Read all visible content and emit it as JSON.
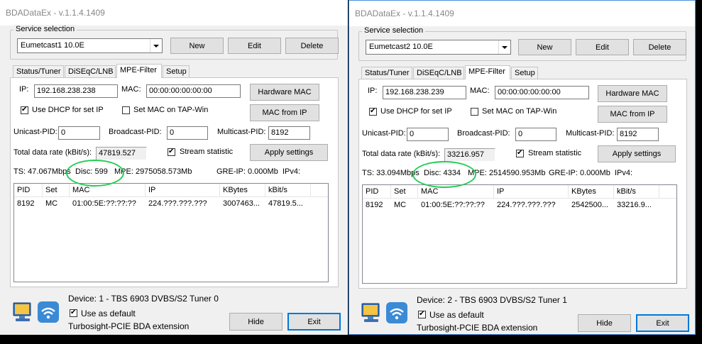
{
  "windows": [
    {
      "title": "BDADataEx - v.1.1.4.1409",
      "service_selection_label": "Service selection",
      "service_selected": "Eumetcast1 10.0E",
      "buttons": {
        "new": "New",
        "edit": "Edit",
        "delete": "Delete",
        "hardware_mac": "Hardware MAC",
        "mac_from_ip": "MAC from IP",
        "apply_settings": "Apply settings",
        "hide": "Hide",
        "exit": "Exit"
      },
      "tabs": [
        "Status/Tuner",
        "DiSEqC/LNB",
        "MPE-Filter",
        "Setup"
      ],
      "active_tab": 2,
      "ip_label": "IP:",
      "ip_value": "192.168.238.238",
      "mac_label": "MAC:",
      "mac_value": "00:00:00:00:00:00",
      "dhcp_label": "Use DHCP for set IP",
      "dhcp_checked": true,
      "set_mac_label": "Set MAC on TAP-Win",
      "set_mac_checked": false,
      "unicast_label": "Unicast-PID:",
      "unicast_value": "0",
      "broadcast_label": "Broadcast-PID:",
      "broadcast_value": "0",
      "multicast_label": "Multicast-PID:",
      "multicast_value": "8192",
      "total_rate_label": "Total data rate (kBit/s):",
      "total_rate_value": "47819.527",
      "stream_stat_label": "Stream statistic",
      "stream_stat_checked": true,
      "status": {
        "ts": "TS: 47.067Mbps",
        "disc": "Disc: 599",
        "mpe": "MPE: 2975058.573Mb",
        "gre": "GRE-IP: 0.000Mb",
        "ipv4": "IPv4:"
      },
      "table": {
        "columns": [
          "PID",
          "Set",
          "MAC",
          "IP",
          "KBytes",
          "kBit/s"
        ],
        "rows": [
          [
            "8192",
            "MC",
            "01:00:5E:??:??:??",
            "224.???.???.???",
            "3007463...",
            "47819.5..."
          ]
        ]
      },
      "device": "Device: 1 - TBS 6903 DVBS/S2 Tuner 0",
      "use_default_label": "Use as default",
      "use_default_checked": true,
      "extension": "Turbosight-PCIE BDA extension",
      "icons": [
        "computer-icon",
        "wifi-icon"
      ],
      "highlight_color": "#22cc55"
    },
    {
      "title": "BDADataEx - v.1.1.4.1409",
      "service_selection_label": "Service selection",
      "service_selected": "Eumetcast2 10.0E",
      "buttons": {
        "new": "New",
        "edit": "Edit",
        "delete": "Delete",
        "hardware_mac": "Hardware MAC",
        "mac_from_ip": "MAC from IP",
        "apply_settings": "Apply settings",
        "hide": "Hide",
        "exit": "Exit"
      },
      "tabs": [
        "Status/Tuner",
        "DiSEqC/LNB",
        "MPE-Filter",
        "Setup"
      ],
      "active_tab": 2,
      "ip_label": "IP:",
      "ip_value": "192.168.238.239",
      "mac_label": "MAC:",
      "mac_value": "00:00:00:00:00:00",
      "dhcp_label": "Use DHCP for set IP",
      "dhcp_checked": true,
      "set_mac_label": "Set MAC on TAP-Win",
      "set_mac_checked": false,
      "unicast_label": "Unicast-PID:",
      "unicast_value": "0",
      "broadcast_label": "Broadcast-PID:",
      "broadcast_value": "0",
      "multicast_label": "Multicast-PID:",
      "multicast_value": "8192",
      "total_rate_label": "Total data rate (kBit/s):",
      "total_rate_value": "33216.957",
      "stream_stat_label": "Stream statistic",
      "stream_stat_checked": true,
      "status": {
        "ts": "TS: 33.094Mbps",
        "disc": "Disc: 4334",
        "mpe": "MPE: 2514590.953Mb",
        "gre": "GRE-IP: 0.000Mb",
        "ipv4": "IPv4:"
      },
      "table": {
        "columns": [
          "PID",
          "Set",
          "MAC",
          "IP",
          "KBytes",
          "kBit/s"
        ],
        "rows": [
          [
            "8192",
            "MC",
            "01:00:5E:??:??:??",
            "224.???.???.???",
            "2542500...",
            "33216.9..."
          ]
        ]
      },
      "device": "Device: 2 - TBS 6903 DVBS/S2 Tuner 1",
      "use_default_label": "Use as default",
      "use_default_checked": true,
      "extension": "Turbosight-PCIE BDA extension",
      "icons": [
        "computer-icon",
        "wifi-icon"
      ],
      "highlight_color": "#22cc55"
    }
  ]
}
